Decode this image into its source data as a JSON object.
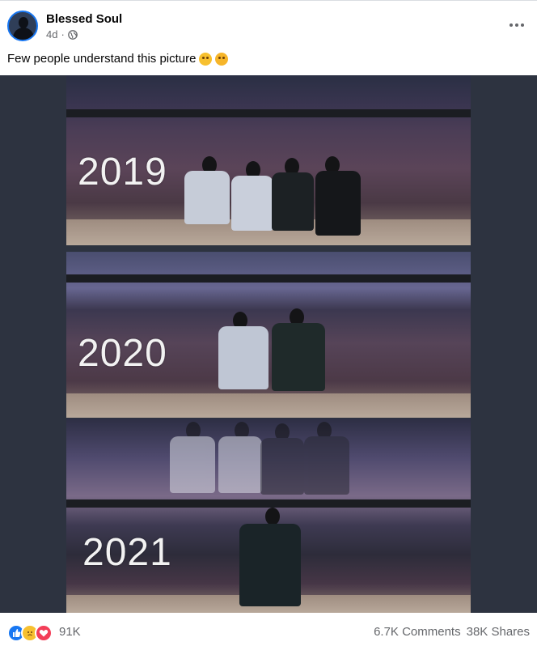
{
  "post": {
    "author": "Blessed Soul",
    "time": "4d",
    "separator": "·",
    "caption": "Few people understand this picture"
  },
  "photo": {
    "years": [
      "2019",
      "2020",
      "2021"
    ]
  },
  "footer": {
    "reaction_count": "91K",
    "comments": "6.7K Comments",
    "shares": "38K Shares"
  },
  "colors": {
    "accent": "#1877f2",
    "secondary_text": "#65676b",
    "love": "#f33e58",
    "sad": "#f7c02f"
  },
  "icons": {
    "privacy": "globe-icon",
    "menu": "more-options-icon",
    "reactions": [
      "like-icon",
      "sad-icon",
      "love-icon"
    ]
  }
}
